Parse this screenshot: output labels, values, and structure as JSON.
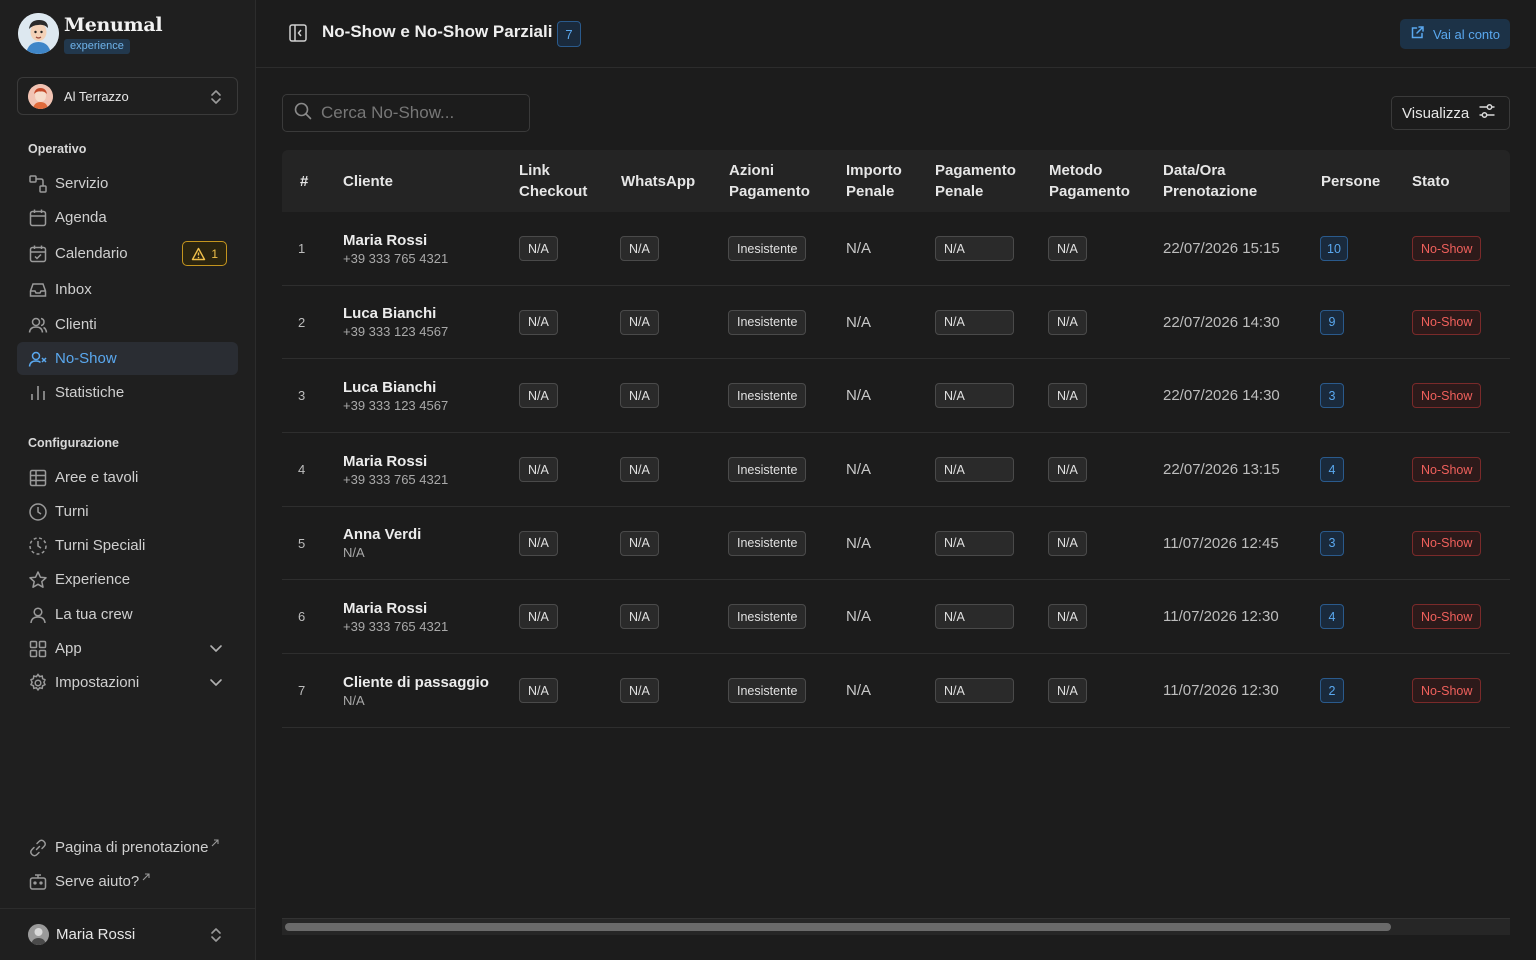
{
  "brand": {
    "name": "Menumal",
    "tag": "experience"
  },
  "venue": {
    "name": "Al Terrazzo"
  },
  "sidebar": {
    "section_operativo": "Operativo",
    "section_config": "Configurazione",
    "items": [
      {
        "label": "Servizio",
        "icon": "route-icon"
      },
      {
        "label": "Agenda",
        "icon": "calendar-icon"
      },
      {
        "label": "Calendario",
        "icon": "calendar-check-icon",
        "badge": "1"
      },
      {
        "label": "Inbox",
        "icon": "inbox-icon"
      },
      {
        "label": "Clienti",
        "icon": "users-icon"
      },
      {
        "label": "No-Show",
        "icon": "user-x-icon",
        "active": true
      },
      {
        "label": "Statistiche",
        "icon": "bar-chart-icon"
      },
      {
        "label": "Aree e tavoli",
        "icon": "table-grid-icon"
      },
      {
        "label": "Turni",
        "icon": "clock-icon"
      },
      {
        "label": "Turni Speciali",
        "icon": "clock-dashed-icon"
      },
      {
        "label": "Experience",
        "icon": "star-icon"
      },
      {
        "label": "La tua crew",
        "icon": "user-icon"
      },
      {
        "label": "App",
        "icon": "apps-icon"
      },
      {
        "label": "Impostazioni",
        "icon": "gear-icon"
      }
    ],
    "booking_page": "Pagina di prenotazione",
    "help": "Serve aiuto?",
    "user": "Maria Rossi"
  },
  "header": {
    "title": "No-Show e No-Show Parziali",
    "count": "7",
    "account_button": "Vai al conto"
  },
  "toolbar": {
    "search_placeholder": "Cerca No-Show...",
    "view_button": "Visualizza"
  },
  "table": {
    "columns": {
      "idx": "#",
      "cliente": "Cliente",
      "link_1": "Link",
      "link_2": "Checkout",
      "whatsapp": "WhatsApp",
      "azioni_1": "Azioni",
      "azioni_2": "Pagamento",
      "importo_1": "Importo",
      "importo_2": "Penale",
      "pagpen_1": "Pagamento",
      "pagpen_2": "Penale",
      "metodo_1": "Metodo",
      "metodo_2": "Pagamento",
      "data_1": "Data/Ora",
      "data_2": "Prenotazione",
      "persone": "Persone",
      "stato": "Stato"
    },
    "rows": [
      {
        "idx": "1",
        "name": "Maria Rossi",
        "phone": "+39 333 765 4321",
        "link": "N/A",
        "whatsapp": "N/A",
        "azioni": "Inesistente",
        "importo": "N/A",
        "pagamento_penale": "N/A",
        "metodo": "N/A",
        "data": "22/07/2026 15:15",
        "persone": "10",
        "stato": "No-Show"
      },
      {
        "idx": "2",
        "name": "Luca Bianchi",
        "phone": "+39 333 123 4567",
        "link": "N/A",
        "whatsapp": "N/A",
        "azioni": "Inesistente",
        "importo": "N/A",
        "pagamento_penale": "N/A",
        "metodo": "N/A",
        "data": "22/07/2026 14:30",
        "persone": "9",
        "stato": "No-Show"
      },
      {
        "idx": "3",
        "name": "Luca Bianchi",
        "phone": "+39 333 123 4567",
        "link": "N/A",
        "whatsapp": "N/A",
        "azioni": "Inesistente",
        "importo": "N/A",
        "pagamento_penale": "N/A",
        "metodo": "N/A",
        "data": "22/07/2026 14:30",
        "persone": "3",
        "stato": "No-Show"
      },
      {
        "idx": "4",
        "name": "Maria Rossi",
        "phone": "+39 333 765 4321",
        "link": "N/A",
        "whatsapp": "N/A",
        "azioni": "Inesistente",
        "importo": "N/A",
        "pagamento_penale": "N/A",
        "metodo": "N/A",
        "data": "22/07/2026 13:15",
        "persone": "4",
        "stato": "No-Show"
      },
      {
        "idx": "5",
        "name": "Anna Verdi",
        "phone": "N/A",
        "link": "N/A",
        "whatsapp": "N/A",
        "azioni": "Inesistente",
        "importo": "N/A",
        "pagamento_penale": "N/A",
        "metodo": "N/A",
        "data": "11/07/2026 12:45",
        "persone": "3",
        "stato": "No-Show"
      },
      {
        "idx": "6",
        "name": "Maria Rossi",
        "phone": "+39 333 765 4321",
        "link": "N/A",
        "whatsapp": "N/A",
        "azioni": "Inesistente",
        "importo": "N/A",
        "pagamento_penale": "N/A",
        "metodo": "N/A",
        "data": "11/07/2026 12:30",
        "persone": "4",
        "stato": "No-Show"
      },
      {
        "idx": "7",
        "name": "Cliente di passaggio",
        "phone": "N/A",
        "link": "N/A",
        "whatsapp": "N/A",
        "azioni": "Inesistente",
        "importo": "N/A",
        "pagamento_penale": "N/A",
        "metodo": "N/A",
        "data": "11/07/2026 12:30",
        "persone": "2",
        "stato": "No-Show"
      }
    ]
  },
  "colors": {
    "accent": "#5aa8ef",
    "danger": "#f0605c",
    "warning": "#f0c04a",
    "background": "#1c1c1c"
  }
}
